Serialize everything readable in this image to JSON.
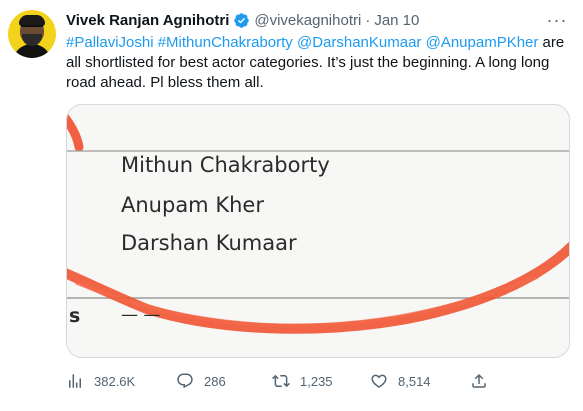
{
  "tweet": {
    "author_name": "Vivek Ranjan Agnihotri",
    "handle": "@vivekagnihotri",
    "separator": "·",
    "date": "Jan 10",
    "more_glyph": "···",
    "text_parts": {
      "tag1": "#PallaviJoshi",
      "tag2": "#MithunChakraborty",
      "tag3": "@DarshanKumaar",
      "tag4": "@AnupamPKher",
      "body": " are all shortlisted for best actor categories. It’s just the beginning. A long long road ahead. Pl bless them all."
    }
  },
  "media": {
    "names": [
      "Mithun Chakraborty",
      "Anupam Kher",
      "Darshan Kumaar"
    ],
    "bottom_letter": "s",
    "bottom_dash": "— —",
    "circle_color": "#f0502e"
  },
  "actions": {
    "views": "382.6K",
    "replies": "286",
    "retweets": "1,235",
    "likes": "8,514"
  },
  "colors": {
    "accent": "#1d9bf0",
    "muted": "#536471"
  }
}
